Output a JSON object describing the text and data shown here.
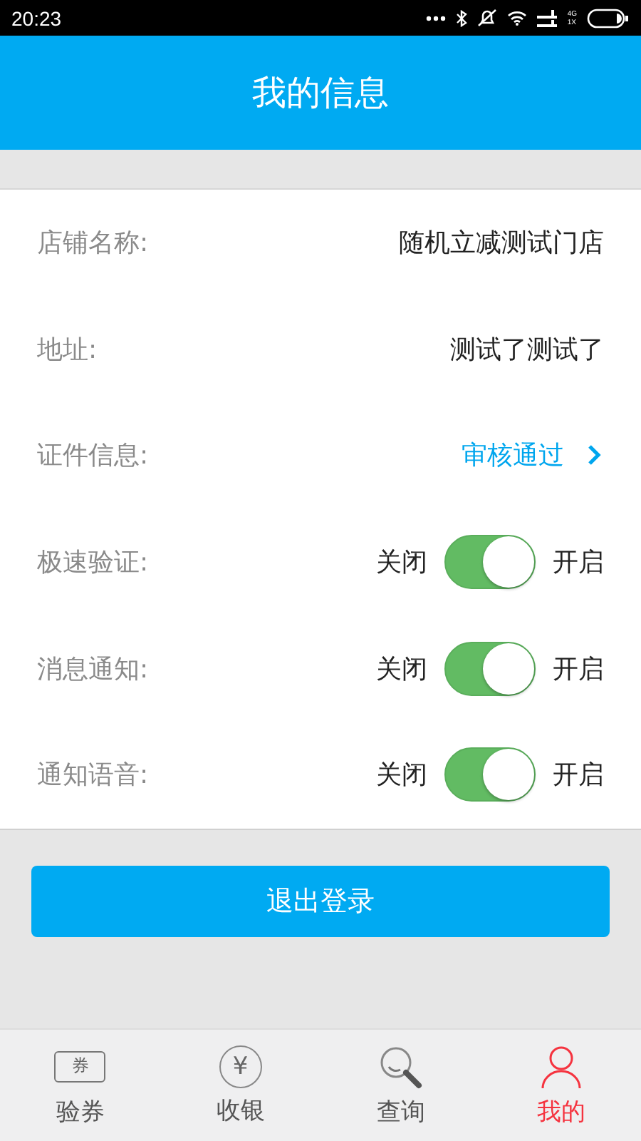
{
  "status_bar": {
    "time": "20:23",
    "network_top": "4G",
    "network_bottom": "1X"
  },
  "header": {
    "title": "我的信息"
  },
  "rows": [
    {
      "kind": "text",
      "label": "店铺名称:",
      "value": "随机立减测试门店"
    },
    {
      "kind": "text",
      "label": "地址:",
      "value": "测试了测试了"
    },
    {
      "kind": "link",
      "label": "证件信息:",
      "value": "审核通过"
    },
    {
      "kind": "toggle",
      "label": "极速验证:",
      "off_label": "关闭",
      "on_label": "开启",
      "on": true
    },
    {
      "kind": "toggle",
      "label": "消息通知:",
      "off_label": "关闭",
      "on_label": "开启",
      "on": true
    },
    {
      "kind": "toggle",
      "label": "通知语音:",
      "off_label": "关闭",
      "on_label": "开启",
      "on": true
    }
  ],
  "logout_button": "退出登录",
  "tab_bar": [
    {
      "kind": "ticket",
      "label": "验券",
      "icon_text": "券",
      "selected": false
    },
    {
      "kind": "yuan",
      "label": "收银",
      "icon_text": "¥",
      "selected": false
    },
    {
      "kind": "search",
      "label": "查询",
      "selected": false
    },
    {
      "kind": "person",
      "label": "我的",
      "selected": true
    }
  ]
}
